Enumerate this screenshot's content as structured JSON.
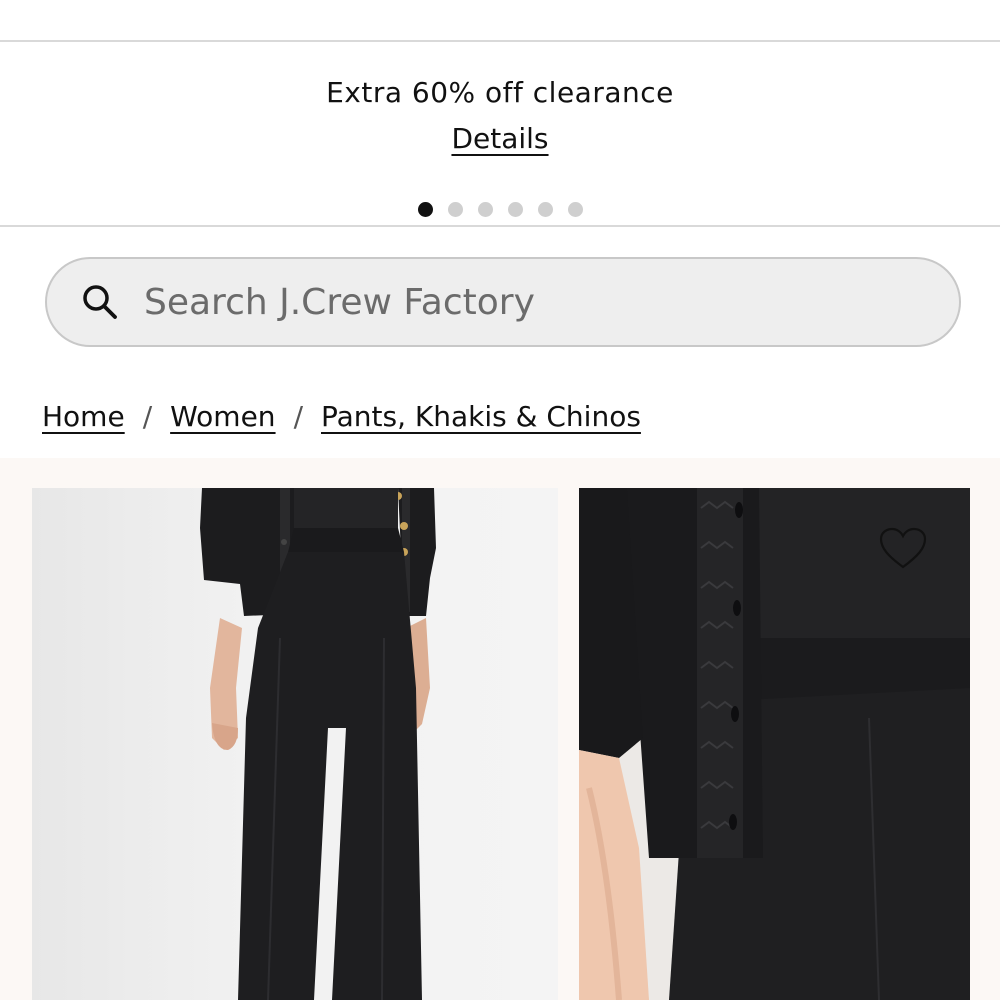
{
  "promo": {
    "text": "Extra 60% off clearance",
    "details_label": "Details",
    "dots_total": 6,
    "dots_active_index": 0
  },
  "search": {
    "placeholder": "Search J.Crew Factory",
    "icon": "search-icon"
  },
  "breadcrumb": {
    "items": [
      "Home",
      "Women",
      "Pants, Khakis & Chinos"
    ],
    "separator": "/"
  },
  "product": {
    "wishlist_icon": "heart-outline-icon",
    "images": [
      "model-front-view",
      "model-detail-close-up"
    ]
  },
  "colors": {
    "background": "#ffffff",
    "gallery_background": "#fcf8f5",
    "dot_active": "#111111",
    "dot_inactive": "#cfcfcf"
  }
}
